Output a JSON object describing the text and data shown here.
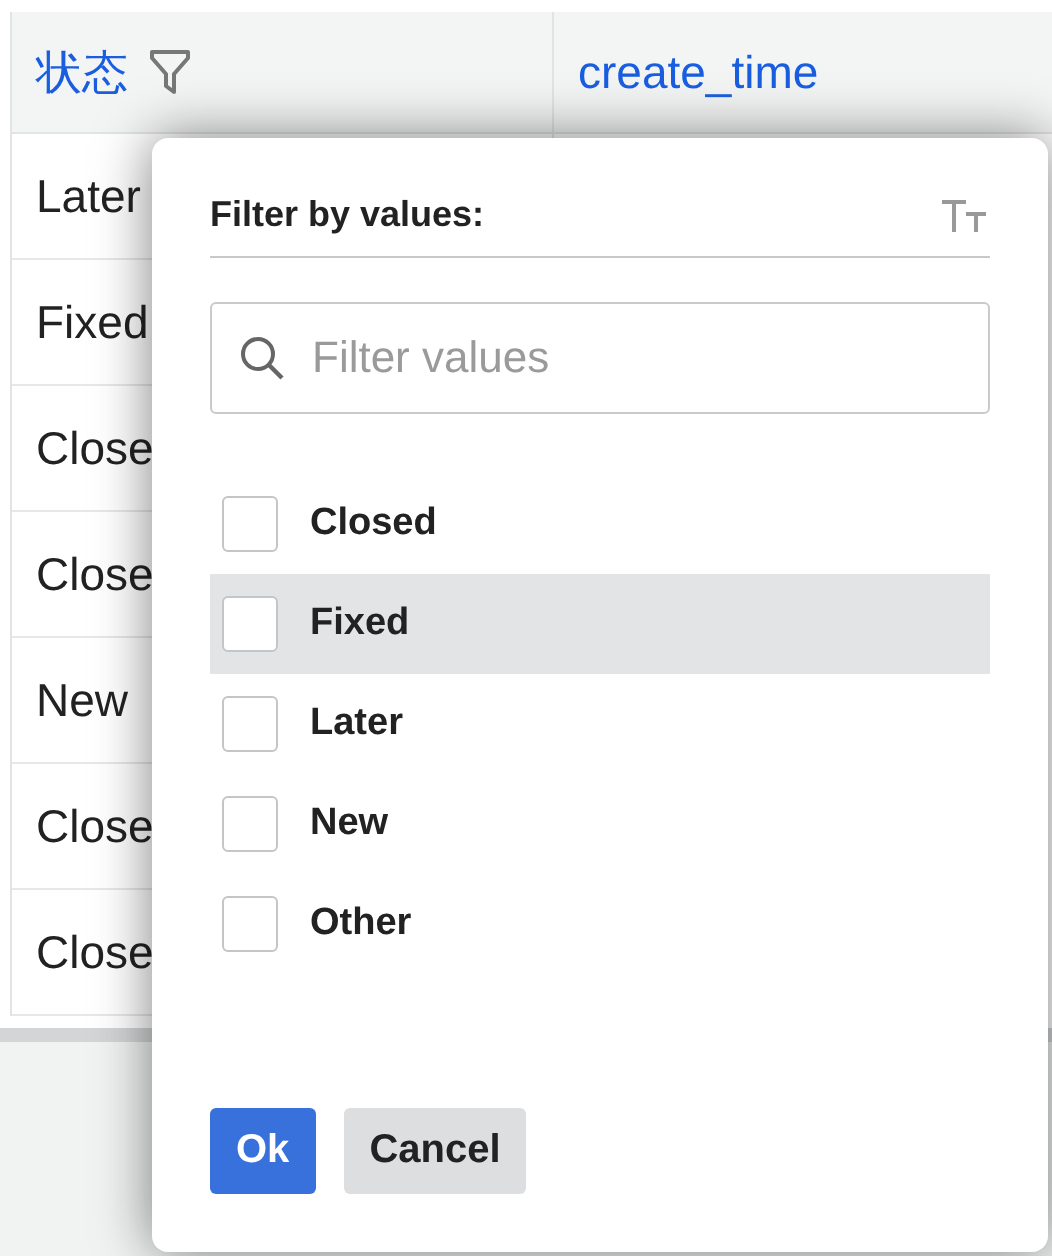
{
  "table": {
    "columns": [
      {
        "label": "状态",
        "kind": "filterable"
      },
      {
        "label": "create_time",
        "kind": "plain"
      }
    ],
    "rows": [
      "Later",
      "Fixed",
      "Close",
      "Close",
      "New",
      "Close",
      "Close"
    ]
  },
  "filter_popup": {
    "title": "Filter by values:",
    "search": {
      "placeholder": "Filter values"
    },
    "options": [
      {
        "label": "Closed",
        "checked": false,
        "selected": false
      },
      {
        "label": "Fixed",
        "checked": false,
        "selected": true
      },
      {
        "label": "Later",
        "checked": false,
        "selected": false
      },
      {
        "label": "New",
        "checked": false,
        "selected": false
      },
      {
        "label": "Other",
        "checked": false,
        "selected": false
      }
    ],
    "buttons": [
      {
        "label": "Ok",
        "kind": "primary"
      },
      {
        "label": "Cancel",
        "kind": "secondary"
      }
    ]
  }
}
